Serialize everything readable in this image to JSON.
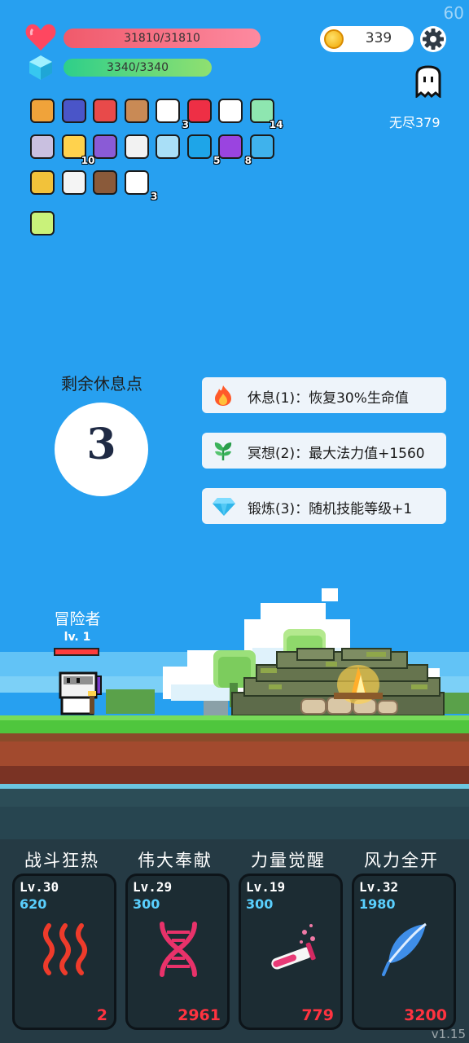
{
  "status": {
    "fps": "60",
    "version": "v1.15"
  },
  "hp": {
    "text": "31810/31810",
    "fraction": 1.0
  },
  "mp": {
    "text": "3340/3340",
    "fraction": 1.0
  },
  "coins": {
    "count": "339"
  },
  "mode": {
    "label": "无尽379"
  },
  "inventory": [
    {
      "name": "book",
      "count": ""
    },
    {
      "name": "wizard-hat",
      "count": ""
    },
    {
      "name": "watermelon",
      "count": ""
    },
    {
      "name": "shield",
      "count": ""
    },
    {
      "name": "ghost",
      "count": "3"
    },
    {
      "name": "strawberry",
      "count": ""
    },
    {
      "name": "target",
      "count": ""
    },
    {
      "name": "green-sprite",
      "count": "14"
    },
    {
      "name": "unicorn",
      "count": ""
    },
    {
      "name": "magic-wand",
      "count": "10"
    },
    {
      "name": "star-chest",
      "count": ""
    },
    {
      "name": "pill",
      "count": ""
    },
    {
      "name": "potion",
      "count": ""
    },
    {
      "name": "blue-gem",
      "count": "5"
    },
    {
      "name": "purple-orb",
      "count": "8"
    },
    {
      "name": "speech-bubble",
      "count": ""
    },
    {
      "name": "ring",
      "count": ""
    },
    {
      "name": "dice",
      "count": ""
    },
    {
      "name": "coconut",
      "count": ""
    },
    {
      "name": "letter",
      "count": "3"
    },
    {
      "name": "lightbulb",
      "count": ""
    }
  ],
  "rest": {
    "title": "剩余休息点",
    "points": "3",
    "options": [
      {
        "label": "休息(1)：恢复30%生命值",
        "icon": "fire-icon"
      },
      {
        "label": "冥想(2)：最大法力值+1560",
        "icon": "leaf-icon"
      },
      {
        "label": "锻炼(3)：随机技能等级+1",
        "icon": "diamond-icon"
      }
    ]
  },
  "hero": {
    "name": "冒险者",
    "level": "lv. 1"
  },
  "skills": [
    {
      "title": "战斗狂热",
      "level": "Lv.30",
      "cost": "620",
      "value": "2",
      "icon": "heat-waves-icon"
    },
    {
      "title": "伟大奉献",
      "level": "Lv.29",
      "cost": "300",
      "value": "2961",
      "icon": "dna-icon"
    },
    {
      "title": "力量觉醒",
      "level": "Lv.19",
      "cost": "300",
      "value": "779",
      "icon": "test-tube-icon"
    },
    {
      "title": "风力全开",
      "level": "Lv.32",
      "cost": "1980",
      "value": "3200",
      "icon": "feather-icon"
    }
  ],
  "colors": {
    "sky": "#27a0f0",
    "hp": "#f05a6b",
    "mp": "#2ecf8a",
    "card_bg": "#1c2c33",
    "cost": "#5ad0ff",
    "value": "#ff3340"
  }
}
